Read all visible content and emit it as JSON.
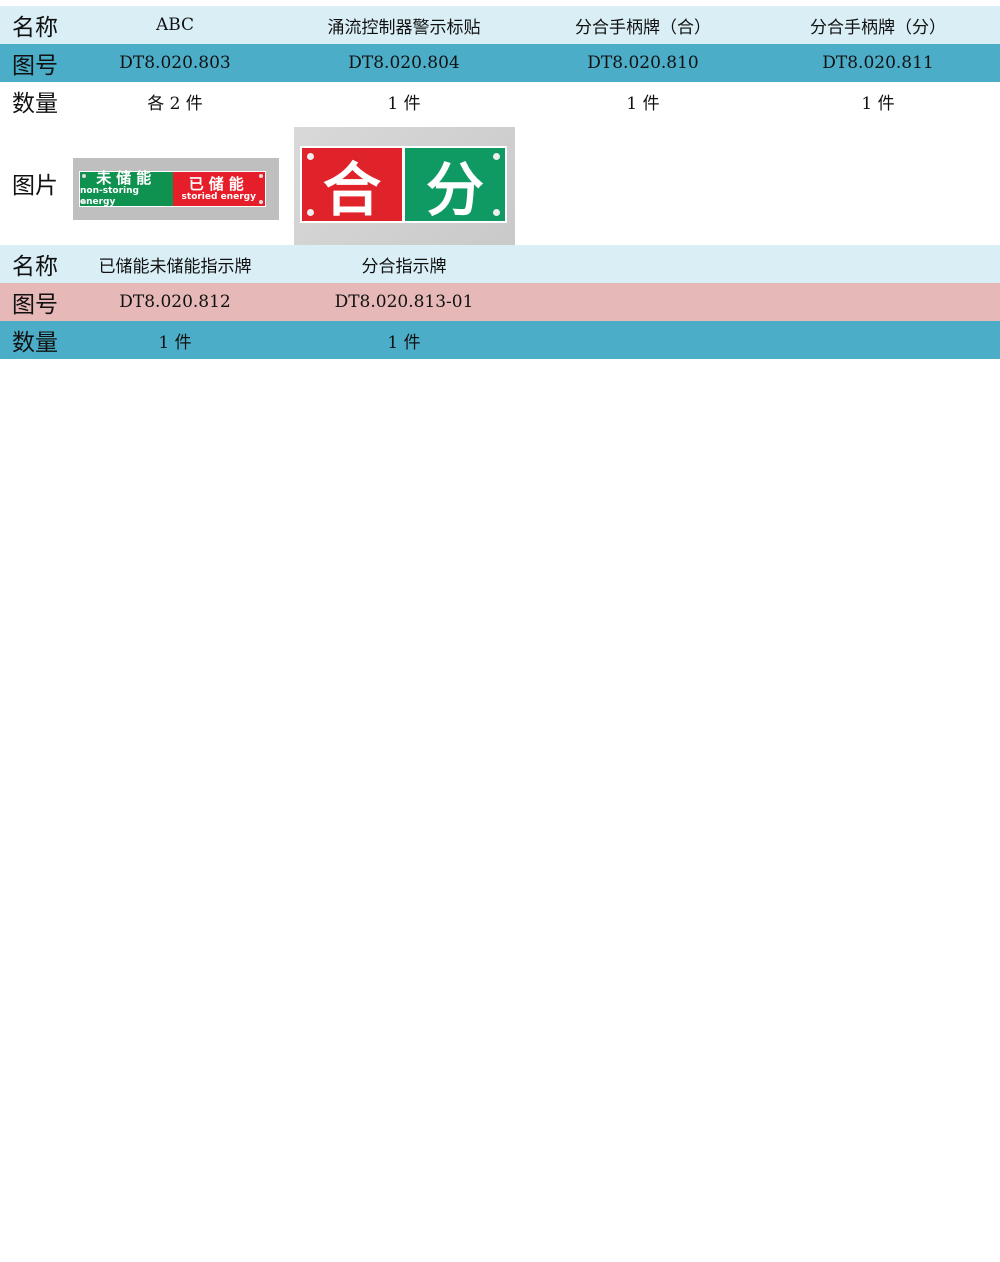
{
  "table1": {
    "row_name": {
      "label": "名称",
      "cells": [
        "ABC",
        "涌流控制器警示标贴",
        "分合手柄牌（合）",
        "分合手柄牌（分）"
      ]
    },
    "row_code": {
      "label": "图号",
      "cells": [
        "DT8.020.803",
        "DT8.020.804",
        "DT8.020.810",
        "DT8.020.811"
      ]
    },
    "row_qty": {
      "label": "数量",
      "cells": [
        "各 2 件",
        "1 件",
        "1 件",
        "1 件"
      ]
    },
    "row_img": {
      "label": "图片"
    }
  },
  "sign1": {
    "left_title": "未储能",
    "left_sub": "non-storing energy",
    "right_title": "已储能",
    "right_sub": "storied energy"
  },
  "sign2": {
    "left": "合",
    "right": "分"
  },
  "table2": {
    "row_name": {
      "label": "名称",
      "cells": [
        "已储能未储能指示牌",
        "分合指示牌",
        "",
        ""
      ]
    },
    "row_code": {
      "label": "图号",
      "cells": [
        "DT8.020.812",
        "DT8.020.813-01",
        "",
        ""
      ]
    },
    "row_qty": {
      "label": "数量",
      "cells": [
        "1 件",
        "1 件",
        "",
        ""
      ]
    }
  },
  "colors": {
    "light_blue": "#d9eef5",
    "teal": "#4badc8",
    "pink": "#e6b8b7",
    "sign_green": "#0f9150",
    "sign_red": "#e61e2a"
  }
}
